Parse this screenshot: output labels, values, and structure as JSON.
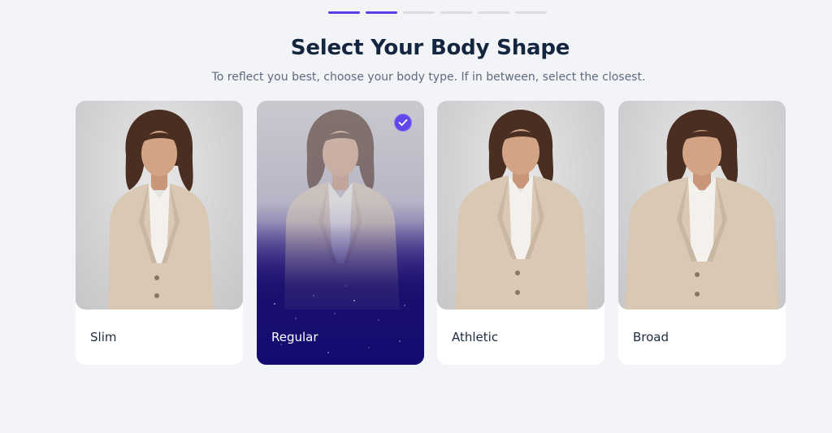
{
  "header": {
    "progress": {
      "total_steps": 6,
      "current_step": 2
    },
    "title": "Select Your Body Shape",
    "subtitle": "To reflect you best, choose your body type. If in between, select the closest."
  },
  "options": [
    {
      "label": "Slim",
      "selected": false
    },
    {
      "label": "Regular",
      "selected": true
    },
    {
      "label": "Athletic",
      "selected": false
    },
    {
      "label": "Broad",
      "selected": false
    }
  ],
  "icons": {
    "selected_marker": "check-icon"
  },
  "colors": {
    "accent": "#5b3ee6",
    "background": "#f3f4f8",
    "title": "#14263f",
    "subtitle": "#5e6a7d",
    "selected_card": "#120c70",
    "suit": "#d8c8b4",
    "shirt": "#f4f1ec",
    "hair": "#4a2e22"
  }
}
